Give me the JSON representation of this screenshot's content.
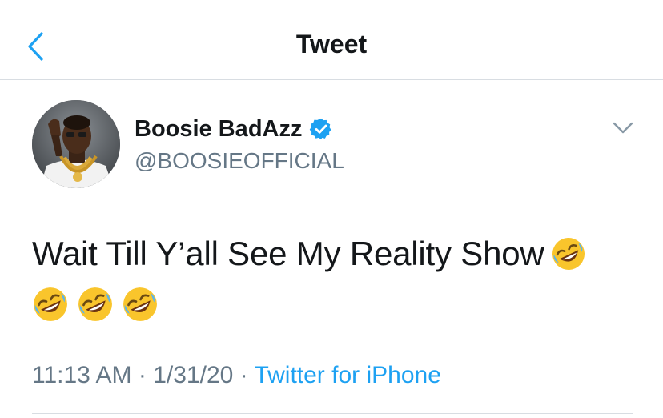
{
  "header": {
    "title": "Tweet",
    "back_icon": "chevron-left-icon",
    "accent_color": "#1da1f2"
  },
  "tweet": {
    "author": {
      "display_name": "Boosie BadAzz",
      "handle": "@BOOSIEOFFICIAL",
      "verified": true,
      "verified_icon": "verified-badge-icon"
    },
    "text": "Wait Till Y’all See My Reality Show",
    "emoji_name": "rolling-on-the-floor-laughing-emoji",
    "emoji_count_inline": 1,
    "emoji_count_second_line": 3,
    "time": "11:13 AM",
    "date": "1/31/20",
    "separator": "·",
    "source": "Twitter for iPhone",
    "menu_icon": "chevron-down-icon"
  },
  "colors": {
    "text_primary": "#14171a",
    "text_secondary": "#657786",
    "link": "#1da1f2",
    "divider": "#d8dde2"
  }
}
